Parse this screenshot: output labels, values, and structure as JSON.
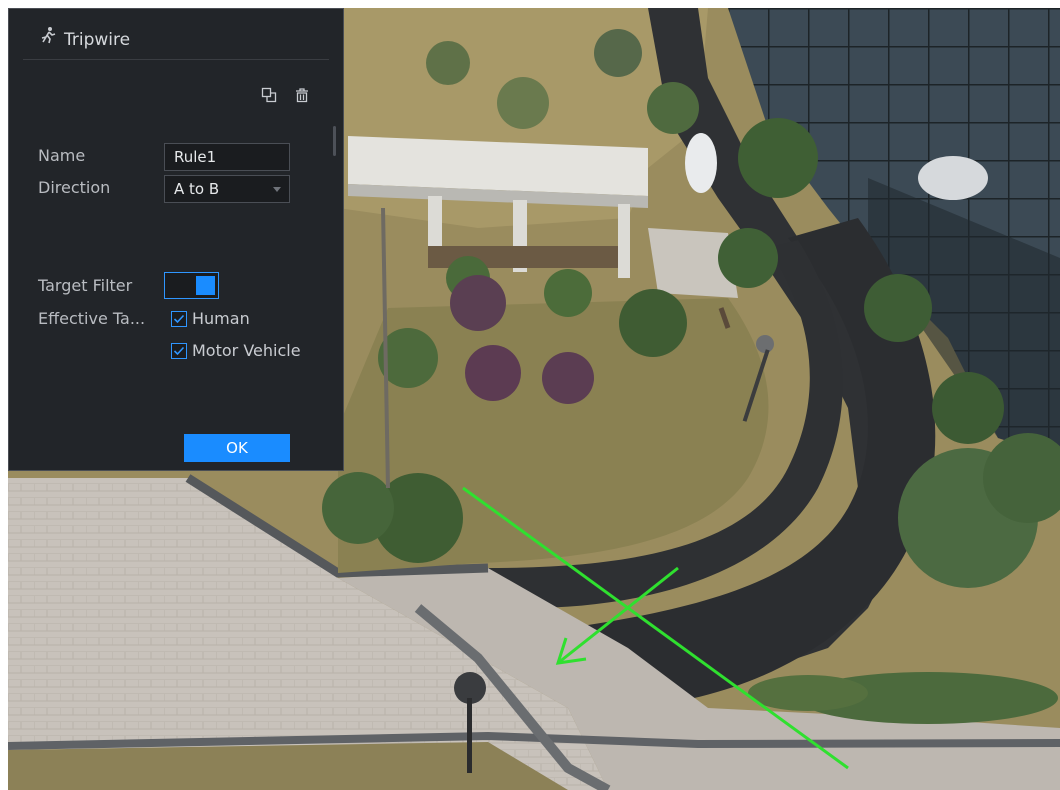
{
  "panel": {
    "title": "Tripwire",
    "icon": "running-person-icon",
    "tools": [
      "copy-icon",
      "trash-icon"
    ]
  },
  "form": {
    "name_label": "Name",
    "name_value": "Rule1",
    "direction_label": "Direction",
    "direction_value": "A to B",
    "target_filter_label": "Target Filter",
    "target_filter_on": true,
    "effective_targets_label": "Effective Ta...",
    "targets": [
      {
        "label": "Human",
        "checked": true
      },
      {
        "label": "Motor Vehicle",
        "checked": true
      }
    ]
  },
  "actions": {
    "ok_label": "OK"
  },
  "colors": {
    "accent": "#1a8cff",
    "tripwire_line": "#2fe02f",
    "panel_bg": "#222529"
  }
}
